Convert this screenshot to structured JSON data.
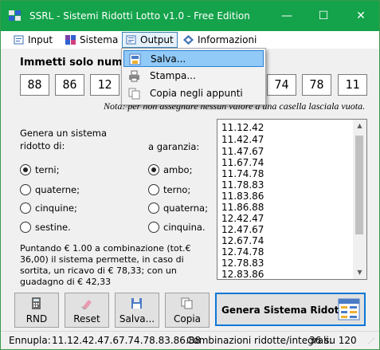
{
  "window": {
    "title": "SSRL - Sistemi Ridotti Lotto v1.0 - Free Edition",
    "controls": {
      "minimize": "—",
      "maximize": "☐",
      "close": "✕"
    }
  },
  "menu": {
    "items": [
      {
        "label": "Input",
        "icon": "input-icon"
      },
      {
        "label": "Sistema",
        "icon": "sistema-icon"
      },
      {
        "label": "Output",
        "icon": "output-icon",
        "open": true
      },
      {
        "label": "Informazioni",
        "icon": "info-icon"
      }
    ]
  },
  "output_menu": {
    "items": [
      {
        "label": "Salva...",
        "icon": "save-icon",
        "highlighted": true
      },
      {
        "label": "Stampa...",
        "icon": "printer-icon"
      },
      {
        "label": "Copia negli appunti",
        "icon": "clipboard-icon"
      }
    ]
  },
  "input_section": {
    "heading": "Immetti solo numeri d",
    "numbers": [
      "88",
      "86",
      "12",
      "",
      "",
      "",
      "",
      "74",
      "78",
      "11"
    ],
    "note": "Nota: per non assegnare nessun valore a una casella lasciala vuota."
  },
  "system": {
    "label": "Genera un sistema ridotto di:",
    "label_lines": [
      "Genera un sistema",
      "ridotto di:"
    ],
    "options": [
      "terni;",
      "quaterne;",
      "cinquine;",
      "sestine."
    ],
    "selected": "terni;"
  },
  "guarantee": {
    "label": "a garanzia:",
    "options": [
      "ambo;",
      "terno;",
      "quaterna;",
      "cinquina."
    ],
    "selected": "ambo;"
  },
  "info_text": "Puntando € 1.00 a combinazione (tot.€ 36,00) il sistema permette, in caso di sortita, un ricavo di € 78,33; con un guadagno di € 42,33",
  "combinations": [
    "11.12.42",
    "11.42.47",
    "11.47.67",
    "11.67.74",
    "11.74.78",
    "11.78.83",
    "11.83.86",
    "11.86.88",
    "12.42.47",
    "12.47.67",
    "12.67.74",
    "12.74.78",
    "12.78.83",
    "12.83.86"
  ],
  "buttons": {
    "rnd": "RND",
    "reset": "Reset",
    "save": "Salva...",
    "copy": "Copia",
    "generate": "Genera Sistema Ridotto"
  },
  "status": {
    "ennupla_label": "Ennupla:",
    "ennupla_value": "11.12.42.47.67.74.78.83.86.88",
    "combos_label": "Combinazioni ridotte/integrali:",
    "combos_value": "36 su 120"
  },
  "colors": {
    "titlebar": "#14a34b",
    "menu_highlight": "#91c9f7",
    "accent_border": "#0a78d7"
  }
}
